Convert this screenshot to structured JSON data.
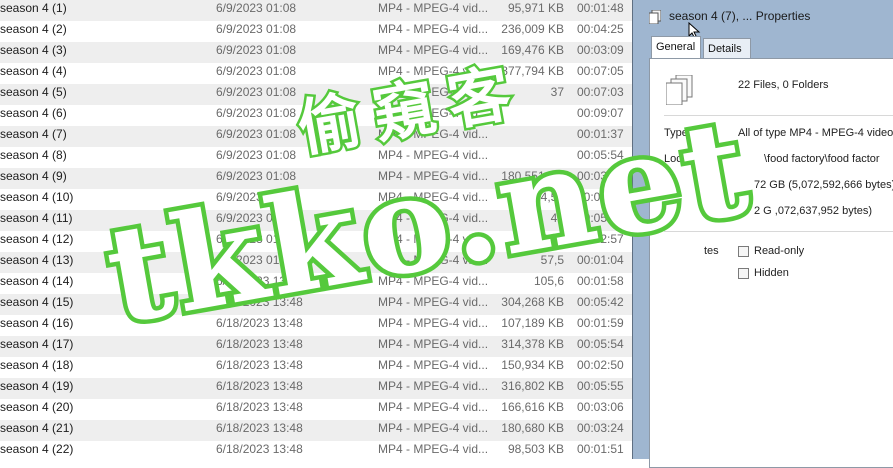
{
  "files": [
    {
      "name": "season 4  (1)",
      "date": "6/9/2023 01:08",
      "type": "MP4 - MPEG-4 vid...",
      "size": "95,971 KB",
      "length": "00:01:48"
    },
    {
      "name": "season 4  (2)",
      "date": "6/9/2023 01:08",
      "type": "MP4 - MPEG-4 vid...",
      "size": "236,009 KB",
      "length": "00:04:25"
    },
    {
      "name": "season 4  (3)",
      "date": "6/9/2023 01:08",
      "type": "MP4 - MPEG-4 vid...",
      "size": "169,476 KB",
      "length": "00:03:09"
    },
    {
      "name": "season 4  (4)",
      "date": "6/9/2023 01:08",
      "type": "MP4 - MPEG-4 vid...",
      "size": "377,794 KB",
      "length": "00:07:05"
    },
    {
      "name": "season 4  (5)",
      "date": "6/9/2023 01:08",
      "type": "MP4 - MPEG-4 vid...",
      "size": "37",
      "length": "00:07:03"
    },
    {
      "name": "season 4  (6)",
      "date": "6/9/2023 01:08",
      "type": "MP4 - MPEG-4 vid...",
      "size": "",
      "length": "00:09:07"
    },
    {
      "name": "season 4  (7)",
      "date": "6/9/2023 01:08",
      "type": "MP4 - MPEG-4 vid...",
      "size": "",
      "length": "00:01:37"
    },
    {
      "name": "season 4  (8)",
      "date": "6/9/2023 01:08",
      "type": "MP4 - MPEG-4 vid...",
      "size": "",
      "length": "00:05:54"
    },
    {
      "name": "season 4  (9)",
      "date": "6/9/2023 01:08",
      "type": "MP4 - MPEG-4 vid...",
      "size": "180,551 KB",
      "length": "00:03:22"
    },
    {
      "name": "season 4  (10)",
      "date": "6/9/2023 01:08",
      "type": "MP4 - MPEG-4 vid...",
      "size": "174,55",
      "length": "00:03:15"
    },
    {
      "name": "season 4  (11)",
      "date": "6/9/2023 01:08",
      "type": "MP4 - MPEG-4 vid...",
      "size": "49",
      "length": "00:05:24"
    },
    {
      "name": "season 4  (12)",
      "date": "6/9/2023 01:08",
      "type": "MP4 - MPEG-4 vid...",
      "size": "158,0",
      "length": "00:02:57"
    },
    {
      "name": "season 4  (13)",
      "date": "6/9/2023 01:08",
      "type": "MP4 - MPEG-4 vid...",
      "size": "57,5",
      "length": "00:01:04"
    },
    {
      "name": "season 4  (14)",
      "date": "6/18/2023 13:48",
      "type": "MP4 - MPEG-4 vid...",
      "size": "105,6",
      "length": "00:01:58"
    },
    {
      "name": "season 4  (15)",
      "date": "6/18/2023 13:48",
      "type": "MP4 - MPEG-4 vid...",
      "size": "304,268 KB",
      "length": "00:05:42"
    },
    {
      "name": "season 4  (16)",
      "date": "6/18/2023 13:48",
      "type": "MP4 - MPEG-4 vid...",
      "size": "107,189 KB",
      "length": "00:01:59"
    },
    {
      "name": "season 4  (17)",
      "date": "6/18/2023 13:48",
      "type": "MP4 - MPEG-4 vid...",
      "size": "314,378 KB",
      "length": "00:05:54"
    },
    {
      "name": "season 4  (18)",
      "date": "6/18/2023 13:48",
      "type": "MP4 - MPEG-4 vid...",
      "size": "150,934 KB",
      "length": "00:02:50"
    },
    {
      "name": "season 4  (19)",
      "date": "6/18/2023 13:48",
      "type": "MP4 - MPEG-4 vid...",
      "size": "316,802 KB",
      "length": "00:05:55"
    },
    {
      "name": "season 4  (20)",
      "date": "6/18/2023 13:48",
      "type": "MP4 - MPEG-4 vid...",
      "size": "166,616 KB",
      "length": "00:03:06"
    },
    {
      "name": "season 4  (21)",
      "date": "6/18/2023 13:48",
      "type": "MP4 - MPEG-4 vid...",
      "size": "180,680 KB",
      "length": "00:03:24"
    },
    {
      "name": "season 4  (22)",
      "date": "6/18/2023 13:48",
      "type": "MP4 - MPEG-4 vid...",
      "size": "98,503 KB",
      "length": "00:01:51"
    }
  ],
  "dialog": {
    "title": "season 4  (7), ... Properties",
    "tabs": [
      "General",
      "Details"
    ],
    "files_count": "22 Files, 0 Folders",
    "type_label": "Type:",
    "type_value": "All of type MP4 - MPEG-4 video fi",
    "location_label": "Location:",
    "location_value": "\\food factory\\food factor",
    "size_value": "72 GB (5,072,592,666 bytes)",
    "size_on_disk_label": "disk:",
    "size_on_disk_value": "2 G   ,072,637,952 bytes)",
    "attributes_label": "tes",
    "readonly_label": "Read-only",
    "hidden_label": "Hidden"
  },
  "watermark": {
    "chinese": "偷窺客",
    "site": "tkko.net",
    "color": "#55c93c"
  }
}
